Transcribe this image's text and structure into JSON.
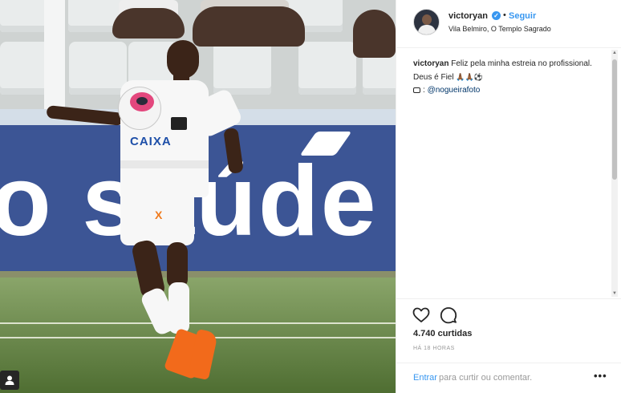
{
  "post": {
    "username": "victoryan",
    "follow_label": "Seguir",
    "follow_separator": "•",
    "location": "Vila Belmiro, O Templo Sagrado",
    "caption_user": "victoryan",
    "caption_text": "Feliz pela minha estreia no profissional. Deus é Fiel",
    "caption_emojis": "🙏🏾🙏🏾⚽",
    "caption_mention": "@nogueirafoto",
    "likes": "4.740 curtidas",
    "time": "HÁ 18 HORAS",
    "login_link": "Entrar",
    "login_rest": "para curtir ou comentar.",
    "more_label": "•••"
  },
  "photo": {
    "ad_text": "o saúde",
    "sponsor": "CAIXA",
    "kit_mark": "X"
  },
  "colors": {
    "accent": "#3897f0",
    "ad_blue": "#3c5595",
    "boot_orange": "#f26a1b"
  },
  "icons": {
    "like": "heart-icon",
    "comment": "comment-bubble-icon",
    "user_tag": "person-icon",
    "verified": "verified-badge-icon"
  }
}
